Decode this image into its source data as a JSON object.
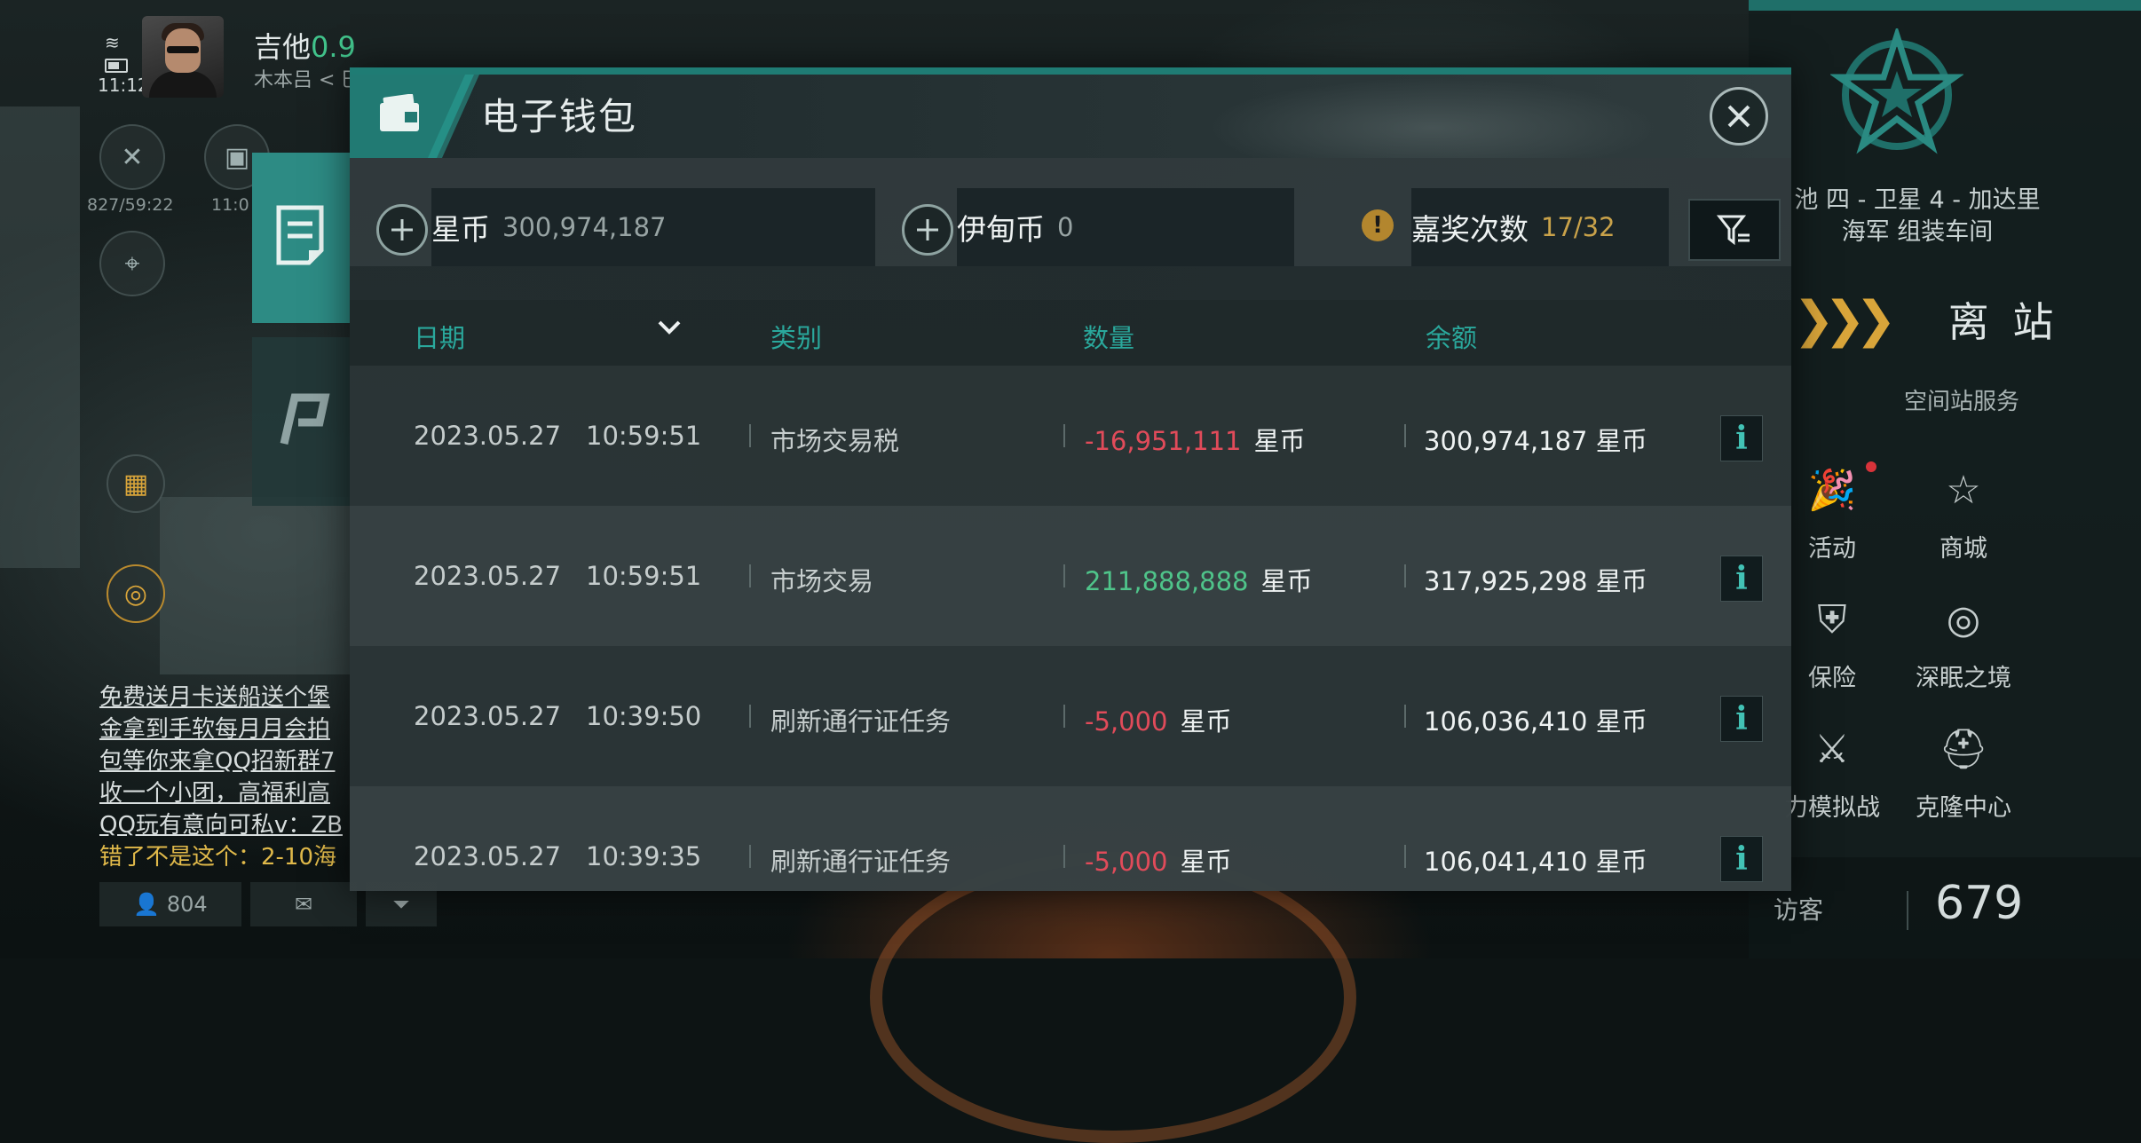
{
  "hud": {
    "player_name": "吉他",
    "security": "0.9",
    "location_sub": "木本吕 < 巴卡...",
    "clock": "11:12",
    "coords": "827/59:22",
    "coords2": "11:0"
  },
  "left_chat": {
    "lines": [
      "免费送月卡送船送个堡",
      "金拿到手软每月月会拍",
      "包等你来拿QQ招新群7",
      "收一个小团，高福利高",
      "QQ玩有意向可私v：ZB",
      "错了不是这个：2-10海"
    ],
    "player_count": "804"
  },
  "dialog": {
    "title": "电子钱包",
    "currencies": [
      {
        "name": "星币",
        "value": "300,974,187"
      },
      {
        "name": "伊甸币",
        "value": "0"
      },
      {
        "name": "嘉奖次数",
        "value": "17/32"
      }
    ],
    "columns": {
      "date": "日期",
      "category": "类别",
      "amount": "数量",
      "balance": "余额"
    },
    "unit": "星币",
    "rows": [
      {
        "date": "2023.05.27",
        "time": "10:59:51",
        "category": "市场交易税",
        "amount": "-16,951,111",
        "sign": "neg",
        "balance": "300,974,187 星币"
      },
      {
        "date": "2023.05.27",
        "time": "10:59:51",
        "category": "市场交易",
        "amount": "211,888,888",
        "sign": "pos",
        "balance": "317,925,298 星币"
      },
      {
        "date": "2023.05.27",
        "time": "10:39:50",
        "category": "刷新通行证任务",
        "amount": "-5,000",
        "sign": "neg",
        "balance": "106,036,410 星币"
      },
      {
        "date": "2023.05.27",
        "time": "10:39:35",
        "category": "刷新通行证任务",
        "amount": "-5,000",
        "sign": "neg",
        "balance": "106,041,410 星币"
      }
    ],
    "info_label": "i"
  },
  "right_panel": {
    "location_line1": "池 四 - 卫星 4 - 加达里",
    "location_line2": "海军 组装车间",
    "undock": "离 站",
    "services_title": "空间站服务",
    "services": [
      {
        "label": "活动",
        "icon": "party-popper-icon"
      },
      {
        "label": "商城",
        "icon": "store-icon"
      },
      {
        "label": "保险",
        "icon": "insurance-icon"
      },
      {
        "label": "深眠之境",
        "icon": "deep-sleep-icon"
      },
      {
        "label": "力模拟战",
        "icon": "simulation-icon"
      },
      {
        "label": "克隆中心",
        "icon": "clone-center-icon"
      }
    ],
    "visitor_label": "访客",
    "visitor_count": "679"
  },
  "colors": {
    "accent": "#2aa89c",
    "negative": "#e14b5a",
    "positive": "#4fc48a",
    "gold": "#c9a24a"
  }
}
